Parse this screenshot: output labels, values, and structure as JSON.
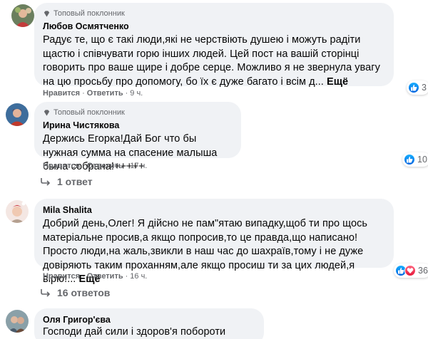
{
  "comments": [
    {
      "badge": "Топовый поклонник",
      "author": "Любов Осмятченко",
      "text": "Радує те, що є такі люди,які не черствіють душею і можуть радіти щастю і співчувати горю інших людей. Цей пост на вашій сторінці говорить про ваше щире і добре серце. Можливо я не звернула увагу на цю просьбу про допомогу, бо їх є дуже багато і всім д...",
      "more": "Ещё",
      "like": "Нравится",
      "reply": "Ответить",
      "time": "9 ч.",
      "reactions_count": "3"
    },
    {
      "badge": "Топовый поклонник",
      "author": "Ирина Чистякова",
      "text": "Держись Егорка!Дай Бог что бы нужная сумма на спасение малыша была собрана!+++++",
      "like": "Нравится",
      "reply": "Ответить",
      "time": "17 ч.",
      "reactions_count": "10",
      "replies": "1 ответ"
    },
    {
      "author": "Mila Shalita",
      "text": "Добрий день,Олег! Я дійсно не пам\"ятаю випадку,щоб ти про щось матеріальне просив,а якщо попросив,то це правда,що написано! Просто люди,на жаль,звикли в наш час до шахраїв,тому і не дуже довіряють таким проханням,але якщо просиш ти за цих людей,я вірю!...",
      "more": "Ещё",
      "like": "Нравится",
      "reply": "Ответить",
      "time": "16 ч.",
      "reactions_count": "36",
      "replies": "16 ответов"
    },
    {
      "author": "Оля Григор'єва",
      "text": "Господи дай сили і здоров'я побороти недугу"
    }
  ],
  "sep": "·",
  "colors": {
    "like_blue": "#0062df",
    "love_red": "#e61739",
    "bubble": "#f0f2f5",
    "secondary": "#65676b"
  }
}
